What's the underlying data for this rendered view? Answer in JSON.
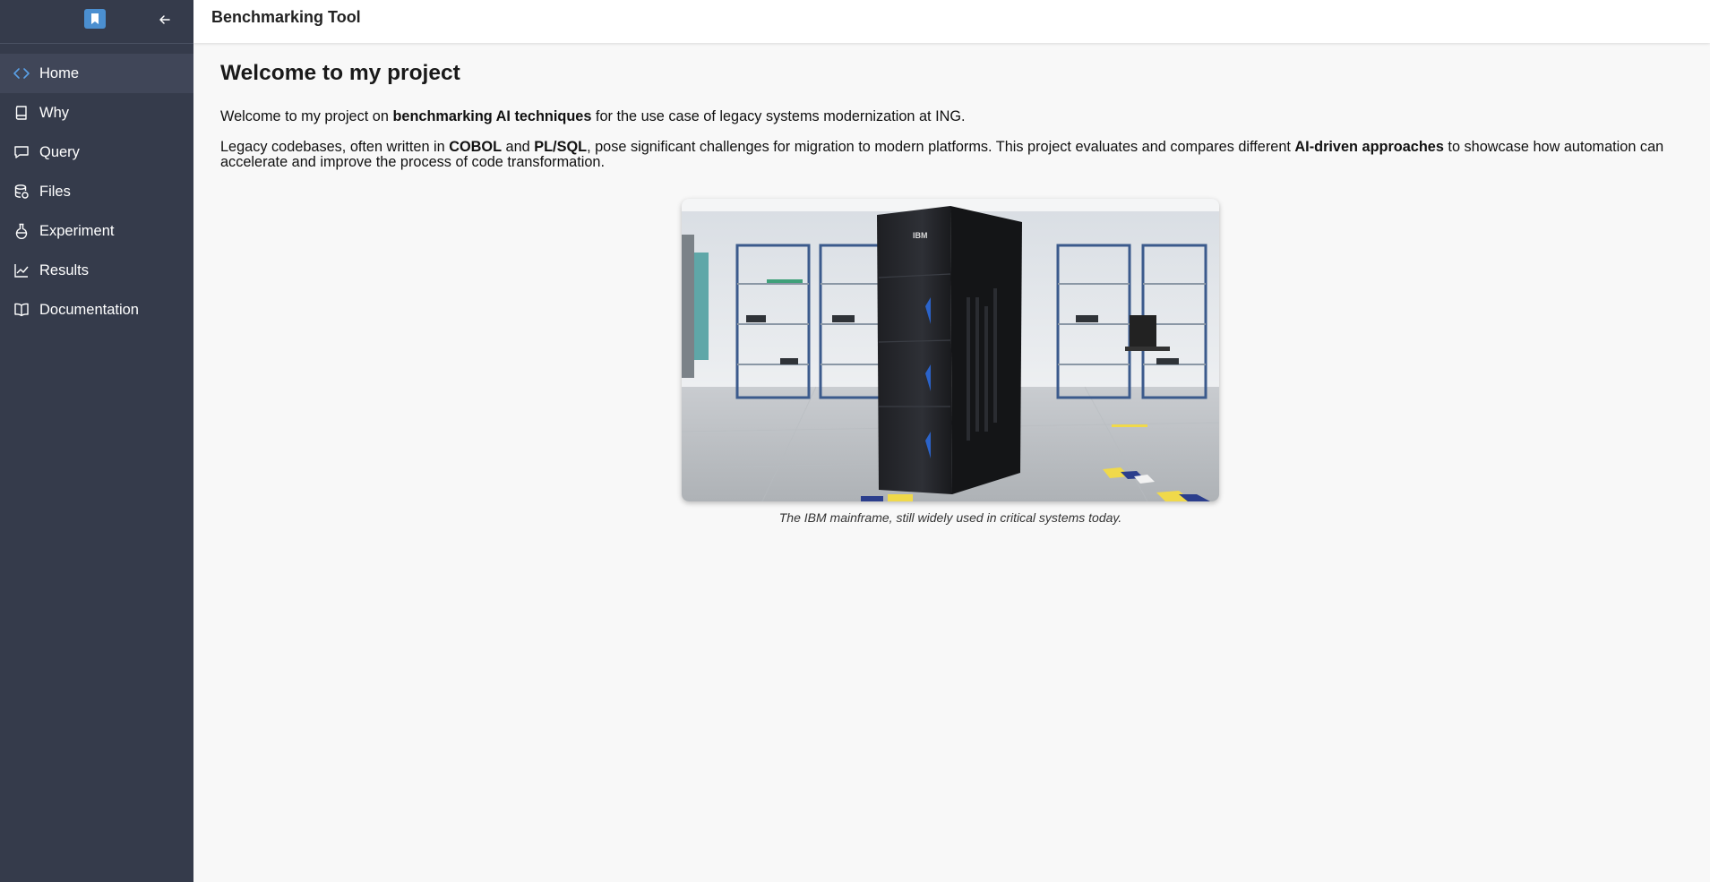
{
  "sidebar": {
    "items": [
      {
        "label": "Home",
        "icon": "code-icon",
        "active": true
      },
      {
        "label": "Why",
        "icon": "book-icon"
      },
      {
        "label": "Query",
        "icon": "chat-icon"
      },
      {
        "label": "Files",
        "icon": "database-icon"
      },
      {
        "label": "Experiment",
        "icon": "flask-icon"
      },
      {
        "label": "Results",
        "icon": "line-chart-icon"
      },
      {
        "label": "Documentation",
        "icon": "open-book-icon"
      }
    ]
  },
  "header": {
    "title": "Benchmarking Tool"
  },
  "main": {
    "title": "Welcome to my project",
    "intro": {
      "t1": "Welcome to my project on ",
      "b1": "benchmarking AI techniques",
      "t2": " for the use case of legacy systems modernization at ING."
    },
    "body": {
      "t1": "Legacy codebases, often written in ",
      "b1": "COBOL",
      "t2": " and ",
      "b2": "PL/SQL",
      "t3": ", pose significant challenges for migration to modern platforms. This project evaluates and compares different ",
      "b3": "AI-driven approaches",
      "t4": " to showcase how automation can accelerate and improve the process of code transformation."
    },
    "figure": {
      "caption": "The IBM mainframe, still widely used in critical systems today.",
      "brand_text": "IBM"
    }
  },
  "colors": {
    "sidebar": "#353b4b",
    "sidebar_active": "#404658",
    "accent": "#4b8fd0",
    "background": "#f8f8f8"
  }
}
